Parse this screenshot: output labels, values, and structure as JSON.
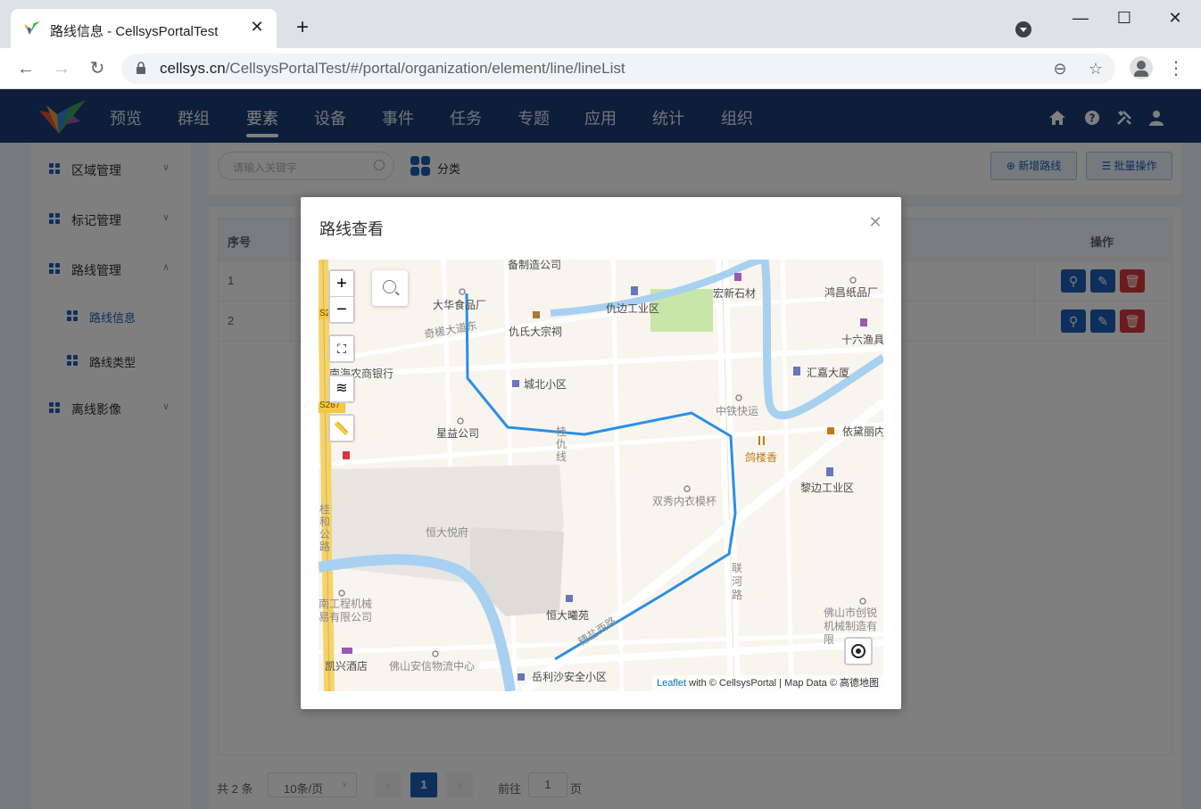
{
  "browser": {
    "tab_title": "路线信息 - CellsysPortalTest",
    "url_host": "cellsys.cn",
    "url_path": "/CellsysPortalTest/#/portal/organization/element/line/lineList"
  },
  "header": {
    "nav": [
      "预览",
      "群组",
      "要素",
      "设备",
      "事件",
      "任务",
      "专题",
      "应用",
      "统计",
      "组织"
    ],
    "active_nav": "要素"
  },
  "sidebar": {
    "items": [
      {
        "label": "区域管理"
      },
      {
        "label": "标记管理"
      },
      {
        "label": "路线管理"
      },
      {
        "label": "路线信息"
      },
      {
        "label": "路线类型"
      },
      {
        "label": "离线影像"
      }
    ]
  },
  "toolbar": {
    "search_placeholder": "请输入关键字",
    "category_label": "分类",
    "add_button": "新增路线",
    "batch_button": "批量操作"
  },
  "table": {
    "headers": {
      "index": "序号",
      "actions": "操作"
    },
    "rows": [
      {
        "index": "1"
      },
      {
        "index": "2"
      }
    ]
  },
  "pagination": {
    "total": "共 2 条",
    "page_size": "10条/页",
    "current_page": "1",
    "goto_label": "前往",
    "goto_value": "1",
    "page_suffix": "页"
  },
  "modal": {
    "title": "路线查看",
    "map": {
      "labels": {
        "l1": "备制造公司",
        "l2": "大华食品厂",
        "l3": "仇边工业区",
        "l4": "宏新石材",
        "l5": "鸿昌纸品厂",
        "l6": "仇氏大宗祠",
        "l7": "奇槎大道东",
        "l8": "十六渔具",
        "l9": "南海农商银行",
        "l10": "城北小区",
        "l11": "汇嘉大厦",
        "l12": "中铁快运",
        "l13": "S267",
        "l14": "星益公司",
        "l15": "桂仇线",
        "l16": "依黛丽内",
        "l17": "鸽楼香",
        "l18": "黎边工业区",
        "l19": "双秀内衣模杯",
        "l20": "桂和公路",
        "l21": "恒大悦府",
        "l22": "联河路",
        "l23": "南工程机械易有限公司",
        "l24": "恒大曦苑",
        "l25": "佛山市创锐机械制造有限",
        "l26": "穗盐西路",
        "l27": "凯兴酒店",
        "l28": "佛山安信物流中心",
        "l29": "岳利沙安全小区",
        "l30": "S2"
      },
      "attribution_link": "Leaflet",
      "attribution_text": " with © CellsysPortal | Map Data © 高德地图",
      "route_color": "#2a8fe6"
    }
  },
  "colors": {
    "header_bg": "#1a3c75",
    "accent": "#1c5fb8",
    "danger": "#d9363e"
  }
}
